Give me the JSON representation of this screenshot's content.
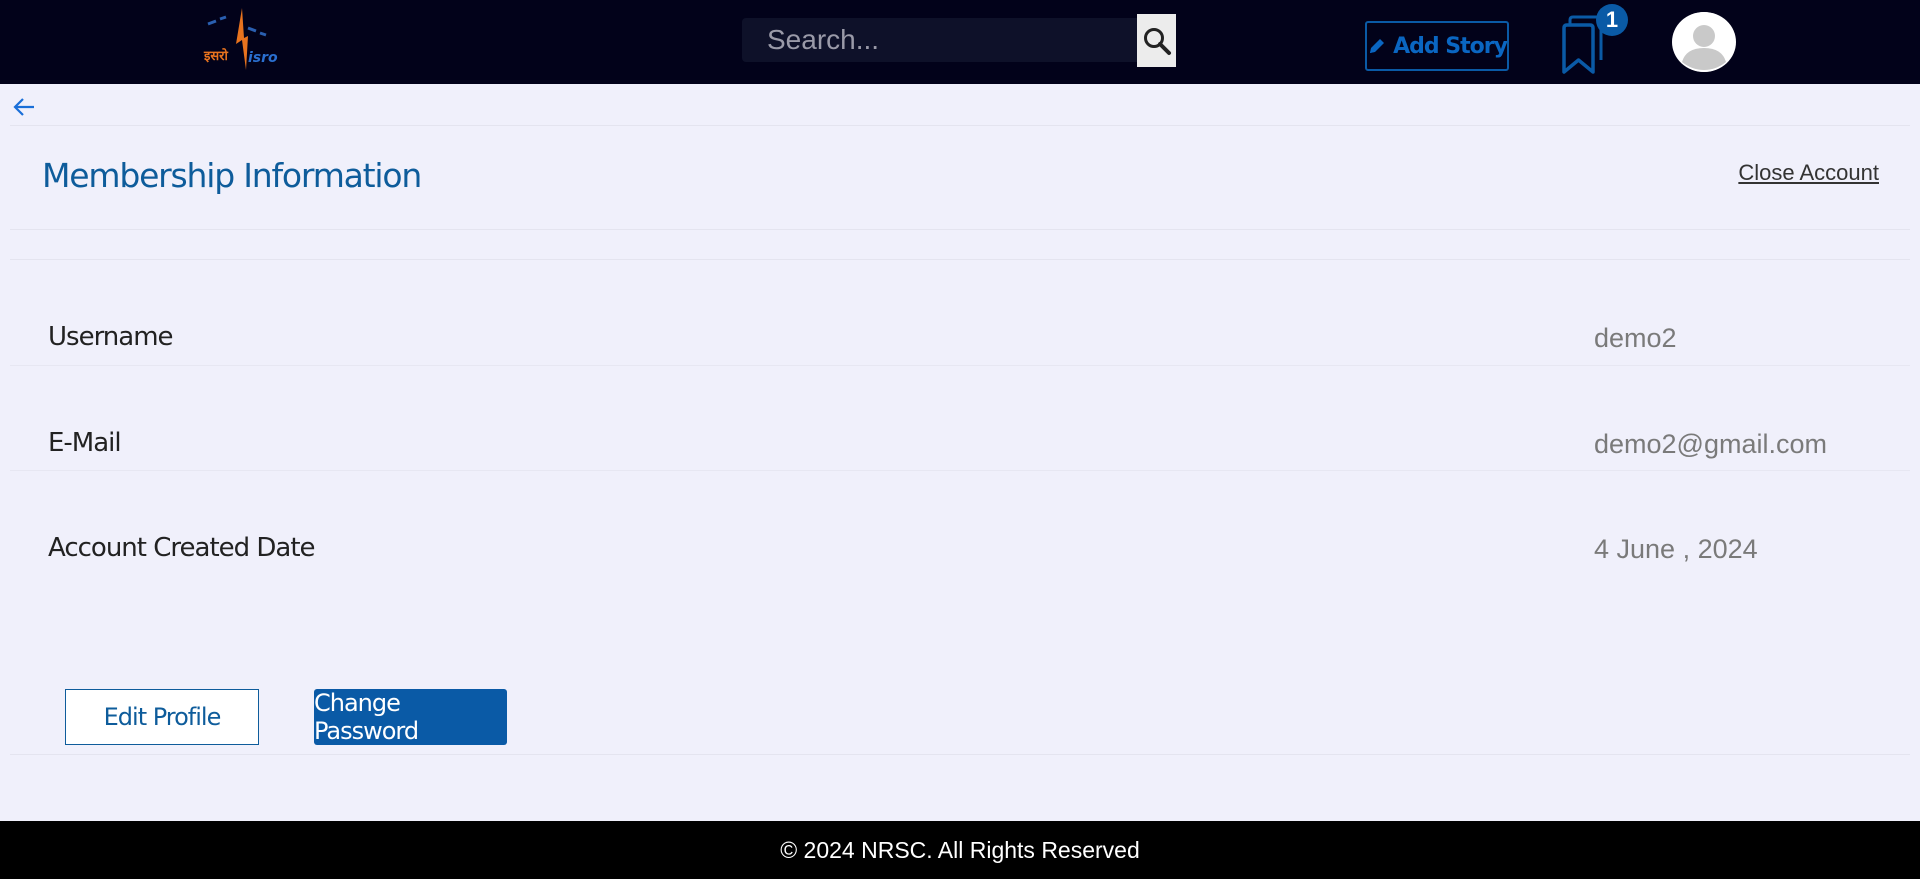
{
  "header": {
    "logo_alt": "isro",
    "search_placeholder": "Search...",
    "add_story_label": "Add Story",
    "bookmark_count": "1"
  },
  "page": {
    "title": "Membership Information",
    "close_account_label": "Close Account"
  },
  "profile": {
    "rows": [
      {
        "label": "Username",
        "value": "demo2"
      },
      {
        "label": "E-Mail",
        "value": "demo2@gmail.com"
      },
      {
        "label": "Account Created Date",
        "value": "4 June , 2024"
      }
    ]
  },
  "actions": {
    "edit_profile_label": "Edit Profile",
    "change_password_label": "Change Password"
  },
  "footer": {
    "copyright": "© 2024 NRSC. All Rights Reserved"
  },
  "colors": {
    "header_bg": "#02021a",
    "accent": "#0a5aa6",
    "title": "#0e5c9b",
    "page_bg": "#f0f0fb",
    "footer_bg": "#000000"
  }
}
